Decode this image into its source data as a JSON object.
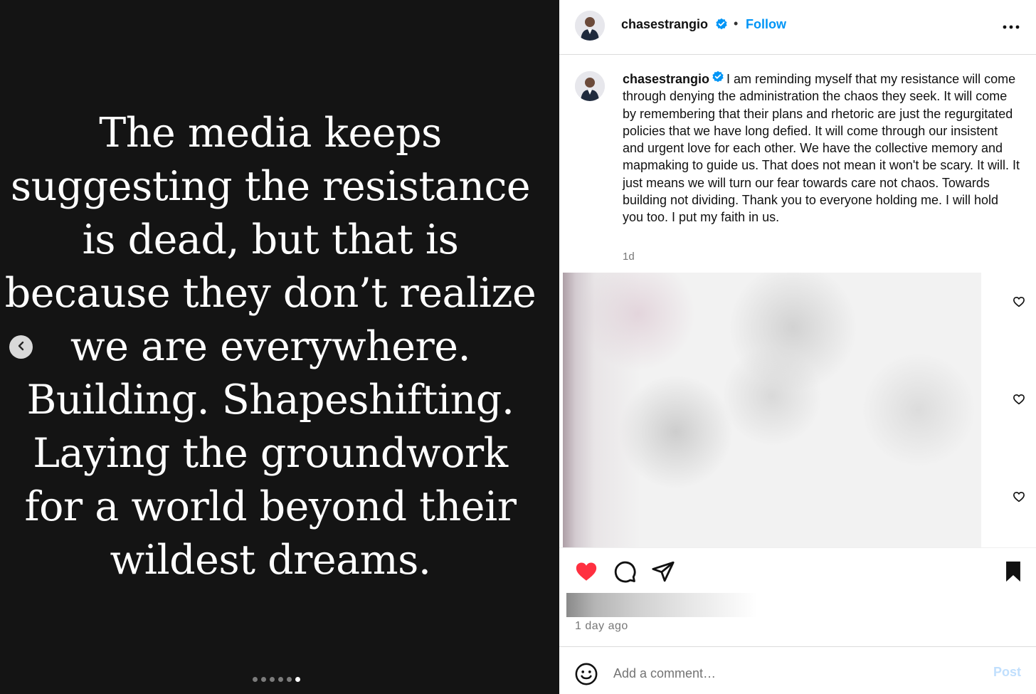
{
  "colors": {
    "media_bg": "#141414",
    "accent_blue": "#0095f6",
    "like_red": "#ff3040",
    "muted_text": "#737373"
  },
  "media": {
    "text_lines": [
      "The media keeps",
      "suggesting the resistance",
      "is dead, but that is",
      "because they don’t realize",
      "we are everywhere.",
      "Building. Shapeshifting.",
      "Laying the groundwork",
      "for a world beyond their",
      "wildest dreams."
    ],
    "carousel_total": 6,
    "carousel_active_index": 5,
    "prev_icon": "chevron-left-icon"
  },
  "header": {
    "username": "chasestrangio",
    "verified_icon": "verified-badge-icon",
    "separator": "•",
    "follow_label": "Follow",
    "more_icon": "more-options-icon"
  },
  "caption": {
    "username": "chasestrangio",
    "text": "I am reminding myself that my resistance will come through denying the administration the chaos they seek. It will come by remembering that their plans and rhetoric are just the regurgitated policies that we have long defied. It will come through our insistent and urgent love for each other. We have the collective memory and mapmaking to guide us. That does not mean it won't be scary. It will. It just means we will turn our fear towards care not chaos. Towards building not dividing. Thank you to everyone holding me. I will hold you too. I put my faith in us.",
    "time": "1d"
  },
  "comment_like_icons": [
    "heart-outline-icon",
    "heart-outline-icon",
    "heart-outline-icon"
  ],
  "actions": {
    "like_icon": "heart-filled-icon",
    "liked": true,
    "comment_icon": "comment-icon",
    "share_icon": "share-icon",
    "save_icon": "bookmark-filled-icon",
    "saved": true
  },
  "post_time": "1 day ago",
  "comment_bar": {
    "emoji_icon": "emoji-icon",
    "placeholder": "Add a comment…",
    "post_label": "Post"
  }
}
